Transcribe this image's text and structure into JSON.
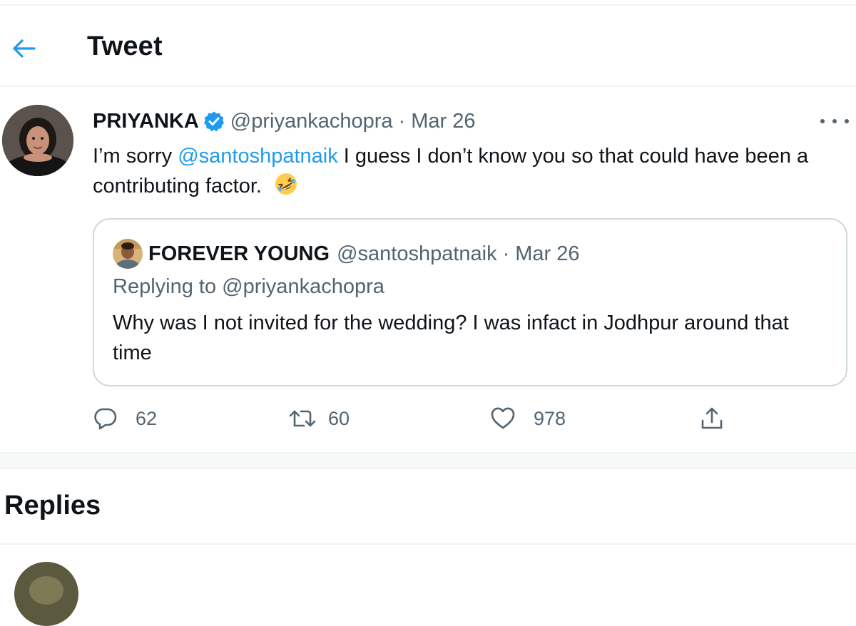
{
  "header": {
    "title": "Tweet",
    "back_icon": "arrow-left-icon",
    "accent": "#1d9bf0"
  },
  "tweet": {
    "display_name": "PRIYANKA",
    "verified_icon": "verified-badge-icon",
    "handle": "@priyankachopra",
    "separator": "·",
    "date": "Mar 26",
    "more_icon": "more-dots-icon",
    "body_prefix": "I’m sorry ",
    "body_mention": "@santoshpatnaik",
    "body_suffix": " I guess I don’t know you so that could have been a contributing factor.",
    "emoji": "rolling-on-the-floor-laughing-emoji"
  },
  "quote": {
    "display_name": "FOREVER YOUNG",
    "handle": "@santoshpatnaik",
    "separator": "·",
    "date": "Mar 26",
    "replying_to": "Replying to @priyankachopra",
    "body": "Why was I not invited for the wedding? I was infact in Jodhpur around that time"
  },
  "actions": {
    "reply": {
      "icon": "reply-bubble-icon",
      "count": "62"
    },
    "retweet": {
      "icon": "retweet-icon",
      "count": "60"
    },
    "like": {
      "icon": "heart-icon",
      "count": "978"
    },
    "share": {
      "icon": "share-icon"
    }
  },
  "replies": {
    "title": "Replies"
  },
  "colors": {
    "text_primary": "#0f1419",
    "text_secondary": "#536471",
    "border": "#cfd9de",
    "link": "#1d9bf0"
  }
}
